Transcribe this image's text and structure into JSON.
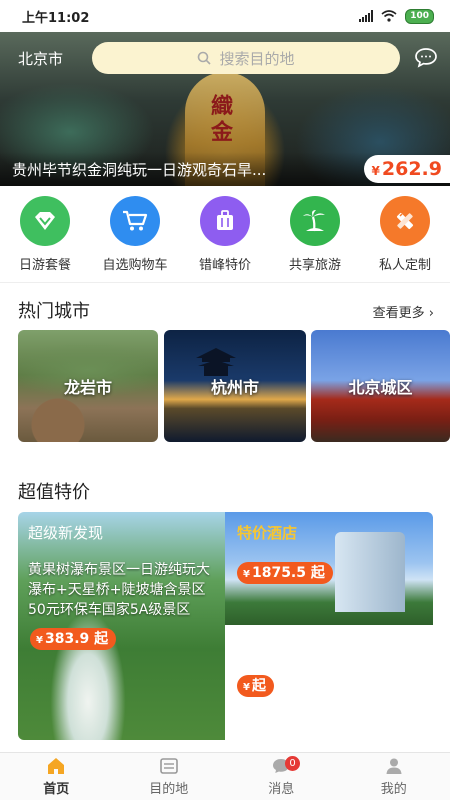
{
  "status_bar": {
    "time": "上午11:02",
    "battery": "100"
  },
  "header": {
    "city": "北京市",
    "search_placeholder": "搜索目的地"
  },
  "banner": {
    "calligraphy": "織金",
    "title": "贵州毕节织金洞纯玩一日游观奇石旱...",
    "currency": "¥",
    "price": "262.9"
  },
  "quick_nav": [
    {
      "label": "日游套餐",
      "icon": "diamond-icon",
      "color": "#3fbf5f"
    },
    {
      "label": "自选购物车",
      "icon": "cart-icon",
      "color": "#2f8df0"
    },
    {
      "label": "错峰特价",
      "icon": "suitcase-icon",
      "color": "#8e5df0"
    },
    {
      "label": "共享旅游",
      "icon": "island-icon",
      "color": "#33b54e"
    },
    {
      "label": "私人定制",
      "icon": "pencil-ruler-icon",
      "color": "#f5792a"
    }
  ],
  "hot_cities": {
    "title": "热门城市",
    "more": "查看更多",
    "cards": [
      {
        "name": "龙岩市"
      },
      {
        "name": "杭州市"
      },
      {
        "name": "北京城区"
      }
    ]
  },
  "deals": {
    "title": "超值特价",
    "left": {
      "tag": "超级新发现",
      "text": "黄果树瀑布景区一日游纯玩大瀑布+天星桥+陡坡塘含景区50元环保车国家5A级景区",
      "currency": "¥",
      "price": "383.9",
      "suffix": "起"
    },
    "right_top": {
      "tag": "特价酒店",
      "currency": "¥",
      "price": "1875.5",
      "suffix": "起"
    },
    "right_bottom": {
      "currency": "¥",
      "suffix": "起"
    }
  },
  "tabs": [
    {
      "label": "首页",
      "icon": "home-icon"
    },
    {
      "label": "目的地",
      "icon": "map-icon"
    },
    {
      "label": "消息",
      "icon": "message-icon",
      "badge": "0"
    },
    {
      "label": "我的",
      "icon": "user-icon"
    }
  ]
}
